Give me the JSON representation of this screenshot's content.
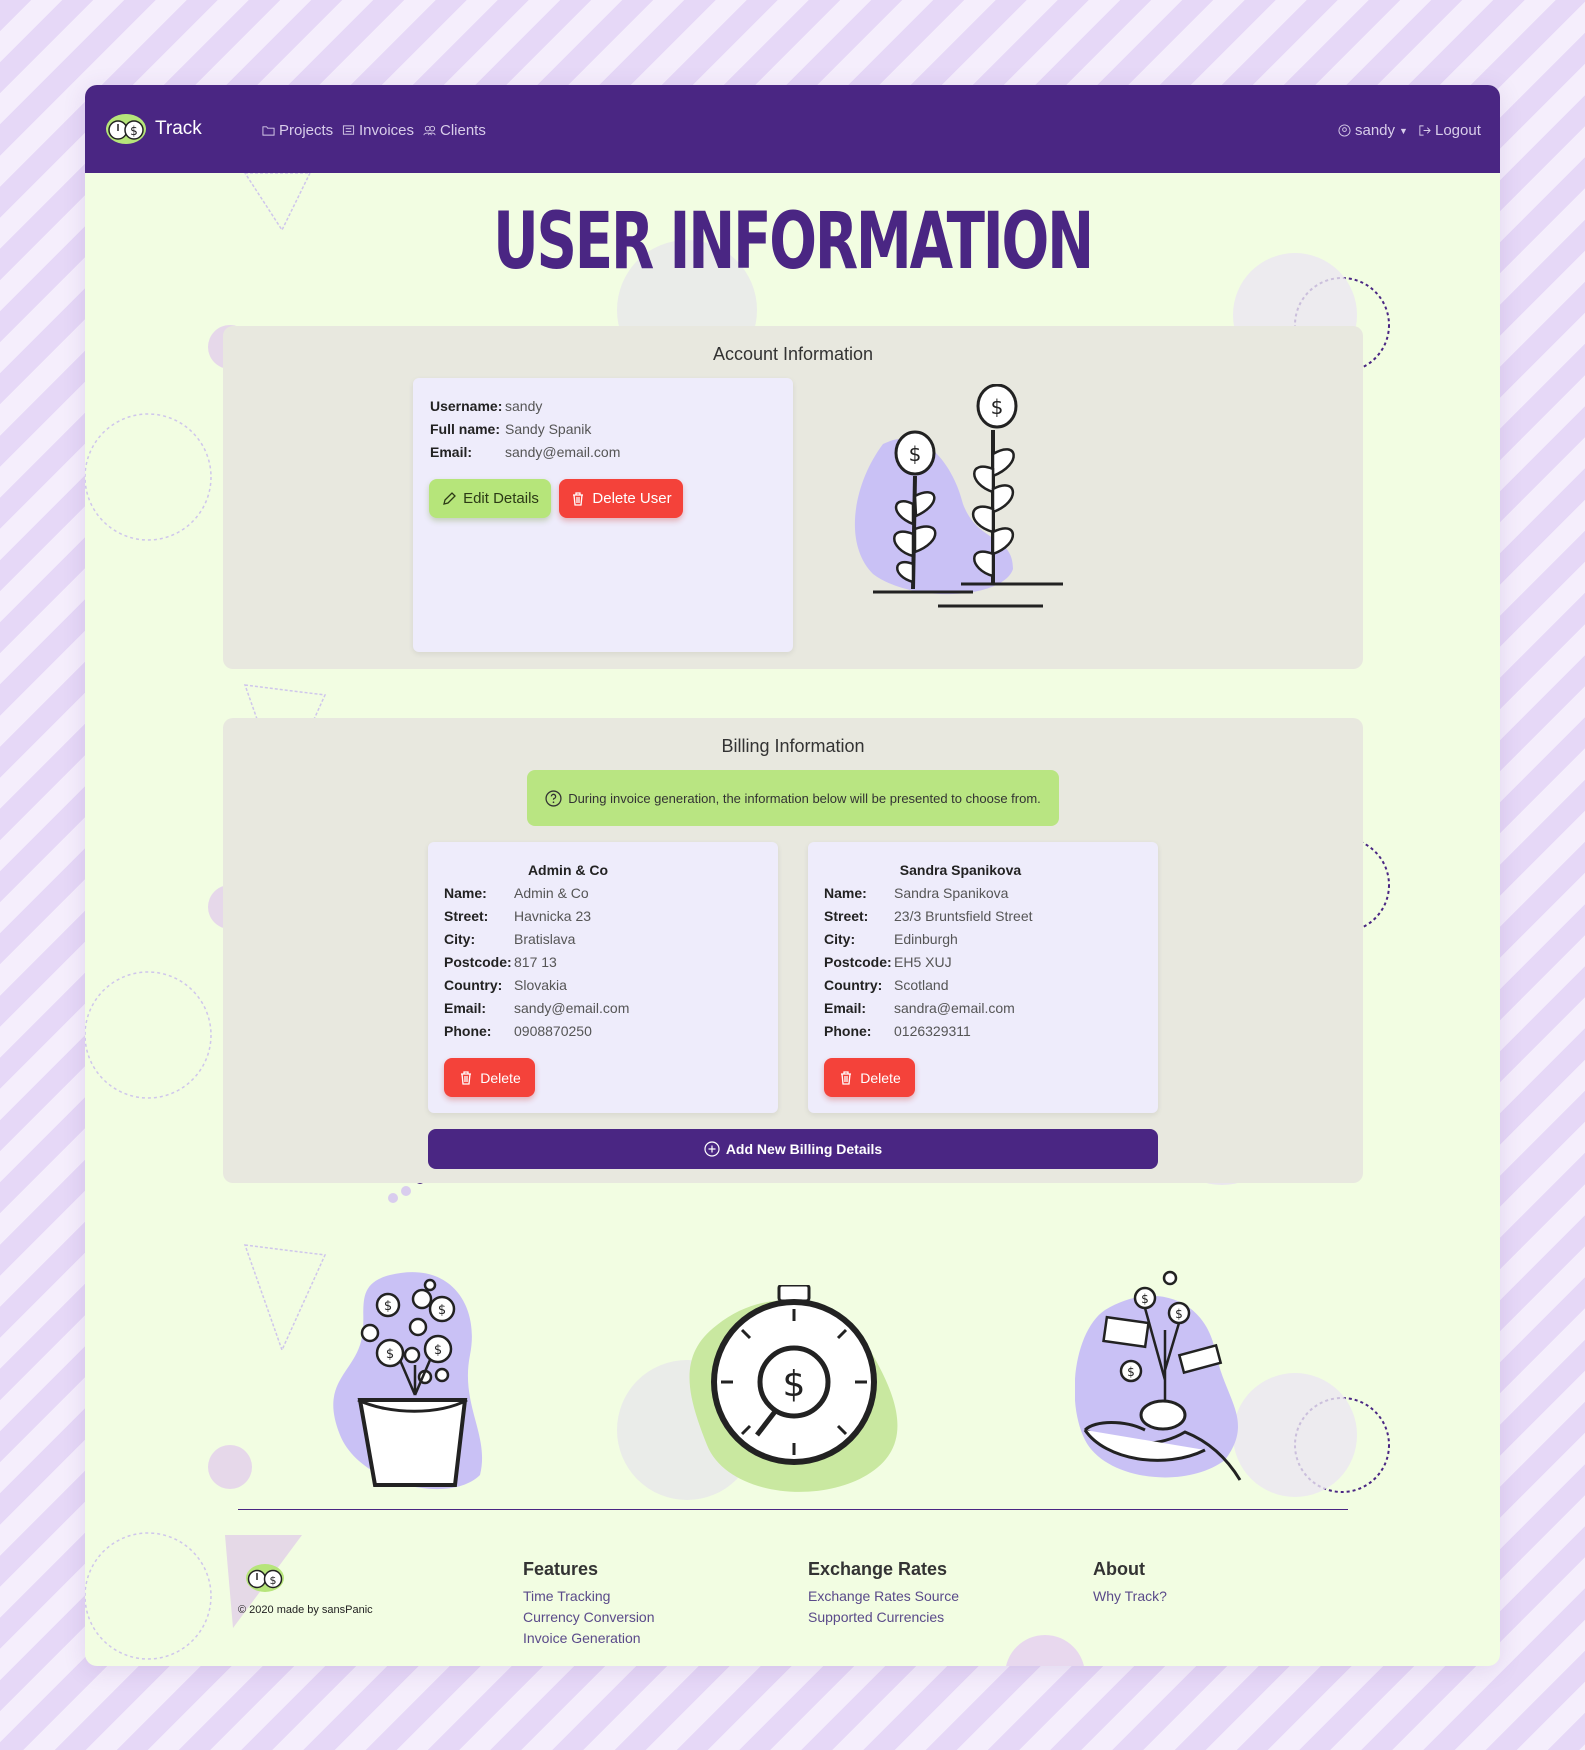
{
  "nav": {
    "brand": "Track",
    "links": [
      "Projects",
      "Invoices",
      "Clients"
    ],
    "user": "sandy",
    "logout": "Logout"
  },
  "page": {
    "title": "USER INFORMATION"
  },
  "account": {
    "title": "Account Information",
    "fields": [
      {
        "label": "Username:",
        "value": "sandy"
      },
      {
        "label": "Full name:",
        "value": "Sandy Spanik"
      },
      {
        "label": "Email:",
        "value": "sandy@email.com"
      }
    ],
    "edit_label": "Edit Details",
    "delete_label": "Delete User"
  },
  "billing": {
    "title": "Billing Information",
    "notice": "During invoice generation, the information below will be presented to choose from.",
    "cards": [
      {
        "title": "Admin & Co",
        "fields": [
          {
            "label": "Name:",
            "value": "Admin & Co"
          },
          {
            "label": "Street:",
            "value": "Havnicka 23"
          },
          {
            "label": "City:",
            "value": "Bratislava"
          },
          {
            "label": "Postcode:",
            "value": "817 13"
          },
          {
            "label": "Country:",
            "value": "Slovakia"
          },
          {
            "label": "Email:",
            "value": "sandy@email.com"
          },
          {
            "label": "Phone:",
            "value": "0908870250"
          }
        ],
        "delete_label": "Delete"
      },
      {
        "title": "Sandra Spanikova",
        "fields": [
          {
            "label": "Name:",
            "value": "Sandra Spanikova"
          },
          {
            "label": "Street:",
            "value": "23/3 Bruntsfield Street"
          },
          {
            "label": "City:",
            "value": "Edinburgh"
          },
          {
            "label": "Postcode:",
            "value": "EH5 XUJ"
          },
          {
            "label": "Country:",
            "value": "Scotland"
          },
          {
            "label": "Email:",
            "value": "sandra@email.com"
          },
          {
            "label": "Phone:",
            "value": "0126329311"
          }
        ],
        "delete_label": "Delete"
      }
    ],
    "add_label": "Add New Billing Details"
  },
  "footer": {
    "copyright": "© 2020 made by sansPanic",
    "columns": [
      {
        "heading": "Features",
        "links": [
          "Time Tracking",
          "Currency Conversion",
          "Invoice Generation"
        ]
      },
      {
        "heading": "Exchange Rates",
        "links": [
          "Exchange Rates Source",
          "Supported Currencies"
        ]
      },
      {
        "heading": "About",
        "links": [
          "Why Track?"
        ]
      }
    ]
  },
  "colors": {
    "nav": "#4a2683",
    "page_bg": "#f2fde2",
    "accent_green": "#b6e57a",
    "danger": "#f4423a",
    "lavender": "#c9c1f5"
  }
}
